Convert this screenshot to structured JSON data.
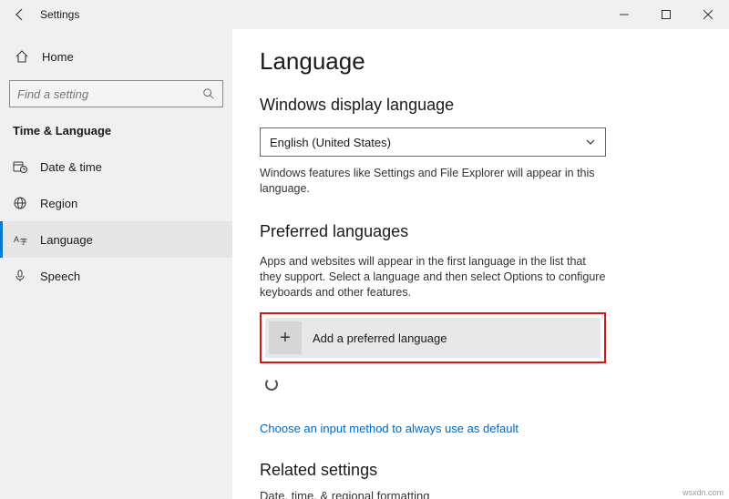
{
  "window": {
    "title": "Settings"
  },
  "sidebar": {
    "home": "Home",
    "search_placeholder": "Find a setting",
    "category": "Time & Language",
    "items": [
      {
        "label": "Date & time"
      },
      {
        "label": "Region"
      },
      {
        "label": "Language"
      },
      {
        "label": "Speech"
      }
    ]
  },
  "content": {
    "page_title": "Language",
    "display_lang_heading": "Windows display language",
    "display_lang_value": "English (United States)",
    "display_lang_desc": "Windows features like Settings and File Explorer will appear in this language.",
    "preferred_heading": "Preferred languages",
    "preferred_desc": "Apps and websites will appear in the first language in the list that they support. Select a language and then select Options to configure keyboards and other features.",
    "add_label": "Add a preferred language",
    "input_method_link": "Choose an input method to always use as default",
    "related_heading": "Related settings",
    "related_link": "Date, time, & regional formatting"
  },
  "watermark": "wsxdn.com"
}
